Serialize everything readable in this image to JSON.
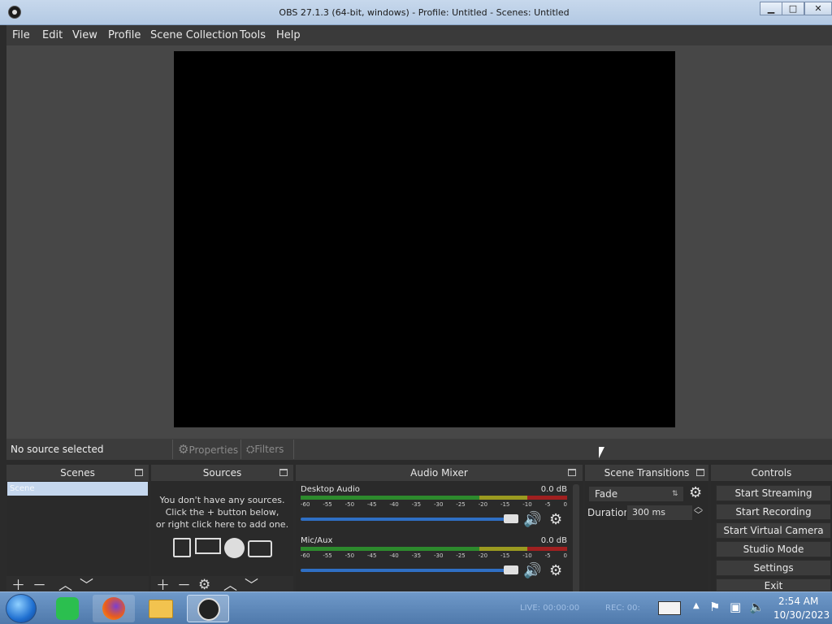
{
  "window": {
    "title": "OBS 27.1.3 (64-bit, windows) - Profile: Untitled - Scenes: Untitled",
    "minimize": "▁",
    "maximize": "□",
    "close": "✕"
  },
  "menu": [
    "File",
    "Edit",
    "View",
    "Profile",
    "Scene Collection",
    "Tools",
    "Help"
  ],
  "source_bar": {
    "status": "No source selected",
    "properties": "Properties",
    "filters": "Filters"
  },
  "docks": {
    "scenes": {
      "title": "Scenes",
      "items": [
        "Scene"
      ]
    },
    "sources": {
      "title": "Sources",
      "empty_line1": "You don't have any sources.",
      "empty_line2": "Click the + button below,",
      "empty_line3": "or right click here to add one."
    },
    "mixer": {
      "title": "Audio Mixer",
      "channels": [
        {
          "name": "Desktop Audio",
          "db": "0.0 dB",
          "volume": 1.0
        },
        {
          "name": "Mic/Aux",
          "db": "0.0 dB",
          "volume": 1.0
        }
      ],
      "ticks": [
        "-60",
        "-55",
        "-50",
        "-45",
        "-40",
        "-35",
        "-30",
        "-25",
        "-20",
        "-15",
        "-10",
        "-5",
        "0"
      ]
    },
    "transitions": {
      "title": "Scene Transitions",
      "selected": "Fade",
      "duration_label": "Duration",
      "duration_value": "300 ms"
    },
    "controls": {
      "title": "Controls",
      "buttons": [
        "Start Streaming",
        "Start Recording",
        "Start Virtual Camera",
        "Studio Mode",
        "Settings",
        "Exit"
      ]
    }
  },
  "taskbar": {
    "live": "LIVE: 00:00:00",
    "rec": "REC: 00:",
    "time": "2:54 AM",
    "date": "10/30/2023"
  },
  "colors": {
    "accent": "#2f6fc4",
    "meter_green": "#2d8a2d",
    "meter_yellow": "#9a9a20",
    "meter_red": "#a02020"
  }
}
